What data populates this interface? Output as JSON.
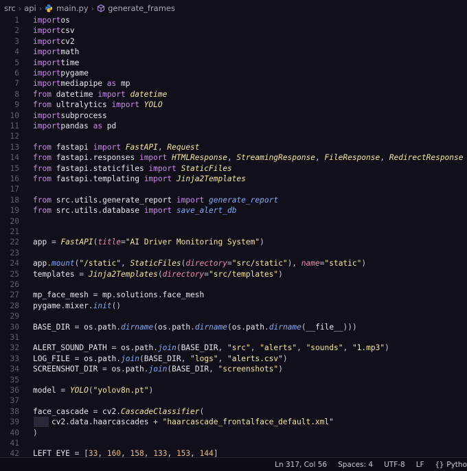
{
  "breadcrumb": {
    "items": [
      "src",
      "api",
      "main.py",
      "generate_frames"
    ]
  },
  "colors": {
    "background": "#11101a",
    "keyword": "#c98ce8",
    "string": "#f1e6a0",
    "function": "#86a8f5",
    "line_number": "#5f5e70"
  },
  "editor": {
    "lines": [
      {
        "n": "1",
        "tokens": [
          [
            "kw",
            "import"
          ],
          [
            "",
            "os"
          ]
        ]
      },
      {
        "n": "2",
        "tokens": [
          [
            "kw",
            "import"
          ],
          [
            "",
            "csv"
          ]
        ]
      },
      {
        "n": "3",
        "tokens": [
          [
            "kw",
            "import"
          ],
          [
            "",
            "cv2"
          ]
        ]
      },
      {
        "n": "4",
        "tokens": [
          [
            "kw",
            "import"
          ],
          [
            "",
            "math"
          ]
        ]
      },
      {
        "n": "5",
        "tokens": [
          [
            "kw",
            "import"
          ],
          [
            "",
            "time"
          ]
        ]
      },
      {
        "n": "6",
        "tokens": [
          [
            "kw",
            "import"
          ],
          [
            "",
            "pygame"
          ]
        ]
      },
      {
        "n": "7",
        "tokens": [
          [
            "kw",
            "import"
          ],
          [
            "",
            "mediapipe "
          ],
          [
            "kw",
            "as"
          ],
          [
            "",
            " mp"
          ]
        ]
      },
      {
        "n": "8",
        "tokens": [
          [
            "kw",
            "from"
          ],
          [
            "",
            " datetime "
          ],
          [
            "kw",
            "import"
          ],
          [
            "cl",
            " datetime"
          ]
        ]
      },
      {
        "n": "9",
        "tokens": [
          [
            "kw",
            "from"
          ],
          [
            "",
            " ultralytics "
          ],
          [
            "kw",
            "import"
          ],
          [
            "cl",
            " YOLO"
          ]
        ]
      },
      {
        "n": "10",
        "tokens": [
          [
            "kw",
            "import"
          ],
          [
            "",
            "subprocess"
          ]
        ]
      },
      {
        "n": "11",
        "tokens": [
          [
            "kw",
            "import"
          ],
          [
            "",
            "pandas "
          ],
          [
            "kw",
            "as"
          ],
          [
            "",
            " pd"
          ]
        ]
      },
      {
        "n": "12",
        "tokens": []
      },
      {
        "n": "13",
        "tokens": [
          [
            "kw",
            "from"
          ],
          [
            "",
            " fastapi "
          ],
          [
            "kw",
            "import"
          ],
          [
            "cl",
            " FastAPI"
          ],
          [
            "pn",
            ", "
          ],
          [
            "cl",
            "Request"
          ]
        ]
      },
      {
        "n": "14",
        "tokens": [
          [
            "kw",
            "from"
          ],
          [
            "",
            " fastapi"
          ],
          [
            "pn",
            "."
          ],
          [
            "",
            "responses "
          ],
          [
            "kw",
            "import"
          ],
          [
            "cl",
            " HTMLResponse"
          ],
          [
            "pn",
            ", "
          ],
          [
            "cl",
            "StreamingResponse"
          ],
          [
            "pn",
            ", "
          ],
          [
            "cl",
            "FileResponse"
          ],
          [
            "pn",
            ", "
          ],
          [
            "cl",
            "RedirectResponse"
          ]
        ]
      },
      {
        "n": "15",
        "tokens": [
          [
            "kw",
            "from"
          ],
          [
            "",
            " fastapi"
          ],
          [
            "pn",
            "."
          ],
          [
            "",
            "staticfiles "
          ],
          [
            "kw",
            "import"
          ],
          [
            "cl",
            " StaticFiles"
          ]
        ]
      },
      {
        "n": "16",
        "tokens": [
          [
            "kw",
            "from"
          ],
          [
            "",
            " fastapi"
          ],
          [
            "pn",
            "."
          ],
          [
            "",
            "templating "
          ],
          [
            "kw",
            "import"
          ],
          [
            "cl",
            " Jinja2Templates"
          ]
        ]
      },
      {
        "n": "17",
        "tokens": []
      },
      {
        "n": "18",
        "tokens": [
          [
            "kw",
            "from"
          ],
          [
            "",
            " src"
          ],
          [
            "pn",
            "."
          ],
          [
            "",
            "utils"
          ],
          [
            "pn",
            "."
          ],
          [
            "",
            "generate_report "
          ],
          [
            "kw",
            "import"
          ],
          [
            "fn",
            " generate_report"
          ]
        ]
      },
      {
        "n": "19",
        "tokens": [
          [
            "kw",
            "from"
          ],
          [
            "",
            " src"
          ],
          [
            "pn",
            "."
          ],
          [
            "",
            "utils"
          ],
          [
            "pn",
            "."
          ],
          [
            "",
            "database "
          ],
          [
            "kw",
            "import"
          ],
          [
            "fn",
            " save_alert_db"
          ]
        ]
      },
      {
        "n": "20",
        "tokens": []
      },
      {
        "n": "21",
        "tokens": []
      },
      {
        "n": "22",
        "tokens": [
          [
            "",
            "app "
          ],
          [
            "op",
            "="
          ],
          [
            "cl",
            " FastAPI"
          ],
          [
            "pn",
            "("
          ],
          [
            "pa",
            "title"
          ],
          [
            "op",
            "="
          ],
          [
            "st",
            "\"AI Driver Monitoring System\""
          ],
          [
            "pn",
            ")"
          ]
        ]
      },
      {
        "n": "23",
        "tokens": []
      },
      {
        "n": "24",
        "tokens": [
          [
            "",
            "app"
          ],
          [
            "pn",
            "."
          ],
          [
            "fn",
            "mount"
          ],
          [
            "pn",
            "("
          ],
          [
            "st",
            "\"/static\""
          ],
          [
            "pn",
            ", "
          ],
          [
            "cl",
            "StaticFiles"
          ],
          [
            "pn",
            "("
          ],
          [
            "pa",
            "directory"
          ],
          [
            "op",
            "="
          ],
          [
            "st",
            "\"src/static\""
          ],
          [
            "pn",
            "), "
          ],
          [
            "pa",
            "name"
          ],
          [
            "op",
            "="
          ],
          [
            "st",
            "\"static\""
          ],
          [
            "pn",
            ")"
          ]
        ]
      },
      {
        "n": "25",
        "tokens": [
          [
            "",
            "templates "
          ],
          [
            "op",
            "="
          ],
          [
            "cl",
            " Jinja2Templates"
          ],
          [
            "pn",
            "("
          ],
          [
            "pa",
            "directory"
          ],
          [
            "op",
            "="
          ],
          [
            "st",
            "\"src/templates\""
          ],
          [
            "pn",
            ")"
          ]
        ]
      },
      {
        "n": "26",
        "tokens": []
      },
      {
        "n": "27",
        "tokens": [
          [
            "",
            "mp_face_mesh "
          ],
          [
            "op",
            "="
          ],
          [
            "",
            " mp"
          ],
          [
            "pn",
            "."
          ],
          [
            "",
            "solutions"
          ],
          [
            "pn",
            "."
          ],
          [
            "",
            "face_mesh"
          ]
        ]
      },
      {
        "n": "28",
        "tokens": [
          [
            "",
            "pygame"
          ],
          [
            "pn",
            "."
          ],
          [
            "",
            "mixer"
          ],
          [
            "pn",
            "."
          ],
          [
            "fn",
            "init"
          ],
          [
            "pn",
            "()"
          ]
        ]
      },
      {
        "n": "29",
        "tokens": []
      },
      {
        "n": "30",
        "tokens": [
          [
            "",
            "BASE_DIR "
          ],
          [
            "op",
            "="
          ],
          [
            "",
            " os"
          ],
          [
            "pn",
            "."
          ],
          [
            "",
            "path"
          ],
          [
            "pn",
            "."
          ],
          [
            "fn",
            "dirname"
          ],
          [
            "pn",
            "("
          ],
          [
            "",
            "os"
          ],
          [
            "pn",
            "."
          ],
          [
            "",
            "path"
          ],
          [
            "pn",
            "."
          ],
          [
            "fn",
            "dirname"
          ],
          [
            "pn",
            "("
          ],
          [
            "",
            "os"
          ],
          [
            "pn",
            "."
          ],
          [
            "",
            "path"
          ],
          [
            "pn",
            "."
          ],
          [
            "fn",
            "dirname"
          ],
          [
            "pn",
            "("
          ],
          [
            "",
            "__file__"
          ],
          [
            "pn",
            ")))"
          ]
        ]
      },
      {
        "n": "31",
        "tokens": []
      },
      {
        "n": "32",
        "tokens": [
          [
            "",
            "ALERT_SOUND_PATH "
          ],
          [
            "op",
            "="
          ],
          [
            "",
            " os"
          ],
          [
            "pn",
            "."
          ],
          [
            "",
            "path"
          ],
          [
            "pn",
            "."
          ],
          [
            "fn",
            "join"
          ],
          [
            "pn",
            "("
          ],
          [
            "",
            "BASE_DIR"
          ],
          [
            "pn",
            ", "
          ],
          [
            "st",
            "\"src\""
          ],
          [
            "pn",
            ", "
          ],
          [
            "st",
            "\"alerts\""
          ],
          [
            "pn",
            ", "
          ],
          [
            "st",
            "\"sounds\""
          ],
          [
            "pn",
            ", "
          ],
          [
            "st",
            "\"1.mp3\""
          ],
          [
            "pn",
            ")"
          ]
        ]
      },
      {
        "n": "33",
        "tokens": [
          [
            "",
            "LOG_FILE "
          ],
          [
            "op",
            "="
          ],
          [
            "",
            " os"
          ],
          [
            "pn",
            "."
          ],
          [
            "",
            "path"
          ],
          [
            "pn",
            "."
          ],
          [
            "fn",
            "join"
          ],
          [
            "pn",
            "("
          ],
          [
            "",
            "BASE_DIR"
          ],
          [
            "pn",
            ", "
          ],
          [
            "st",
            "\"logs\""
          ],
          [
            "pn",
            ", "
          ],
          [
            "st",
            "\"alerts.csv\""
          ],
          [
            "pn",
            ")"
          ]
        ]
      },
      {
        "n": "34",
        "tokens": [
          [
            "",
            "SCREENSHOT_DIR "
          ],
          [
            "op",
            "="
          ],
          [
            "",
            " os"
          ],
          [
            "pn",
            "."
          ],
          [
            "",
            "path"
          ],
          [
            "pn",
            "."
          ],
          [
            "fn",
            "join"
          ],
          [
            "pn",
            "("
          ],
          [
            "",
            "BASE_DIR"
          ],
          [
            "pn",
            ", "
          ],
          [
            "st",
            "\"screenshots\""
          ],
          [
            "pn",
            ")"
          ]
        ]
      },
      {
        "n": "35",
        "tokens": []
      },
      {
        "n": "36",
        "tokens": [
          [
            "",
            "model "
          ],
          [
            "op",
            "="
          ],
          [
            "cl",
            " YOLO"
          ],
          [
            "pn",
            "("
          ],
          [
            "st",
            "\"yolov8n.pt\""
          ],
          [
            "pn",
            ")"
          ]
        ]
      },
      {
        "n": "37",
        "tokens": []
      },
      {
        "n": "38",
        "tokens": [
          [
            "",
            "face_cascade "
          ],
          [
            "op",
            "="
          ],
          [
            "",
            " cv2"
          ],
          [
            "pn",
            "."
          ],
          [
            "cl",
            "CascadeClassifier"
          ],
          [
            "pn",
            "("
          ]
        ]
      },
      {
        "n": "39",
        "tokens": [
          [
            "",
            "    cv2"
          ],
          [
            "pn",
            "."
          ],
          [
            "",
            "data"
          ],
          [
            "pn",
            "."
          ],
          [
            "",
            "haarcascades "
          ],
          [
            "op",
            "+"
          ],
          [
            "st",
            " \"haarcascade_frontalface_default.xml\""
          ]
        ]
      },
      {
        "n": "40",
        "tokens": [
          [
            "pn",
            ")"
          ]
        ]
      },
      {
        "n": "41",
        "tokens": []
      },
      {
        "n": "42",
        "tokens": [
          [
            "",
            "LEFT_EYE "
          ],
          [
            "op",
            "="
          ],
          [
            "pn",
            " ["
          ],
          [
            "nm",
            "33"
          ],
          [
            "pn",
            ", "
          ],
          [
            "nm",
            "160"
          ],
          [
            "pn",
            ", "
          ],
          [
            "nm",
            "158"
          ],
          [
            "pn",
            ", "
          ],
          [
            "nm",
            "133"
          ],
          [
            "pn",
            ", "
          ],
          [
            "nm",
            "153"
          ],
          [
            "pn",
            ", "
          ],
          [
            "nm",
            "144"
          ],
          [
            "pn",
            "]"
          ]
        ]
      }
    ]
  },
  "status": {
    "position": "Ln 317, Col 56",
    "spaces": "Spaces: 4",
    "encoding": "UTF-8",
    "eol": "LF",
    "language": "Pytho"
  }
}
